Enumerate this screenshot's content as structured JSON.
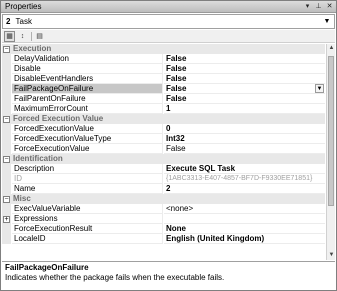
{
  "window": {
    "title": "Properties",
    "buttons": [
      "▾",
      "✕",
      "✕"
    ]
  },
  "selector": {
    "number": "2",
    "text": "Task"
  },
  "toolbar": {
    "tools": [
      {
        "name": "categorized-icon",
        "glyph": "▦",
        "active": true
      },
      {
        "name": "alphabetical-icon",
        "glyph": "↓",
        "active": false
      },
      {
        "name": "property-pages-icon",
        "glyph": "▤",
        "active": false
      }
    ]
  },
  "grid": {
    "rows": [
      {
        "kind": "cat",
        "label": "Execution",
        "toggle": "−"
      },
      {
        "kind": "prop",
        "name": "DelayValidation",
        "value": "False",
        "bold": true
      },
      {
        "kind": "prop",
        "name": "Disable",
        "value": "False",
        "bold": true
      },
      {
        "kind": "prop",
        "name": "DisableEventHandlers",
        "value": "False",
        "bold": true
      },
      {
        "kind": "prop",
        "name": "FailPackageOnFailure",
        "value": "False",
        "bold": true,
        "selected": true,
        "dropdown": true
      },
      {
        "kind": "prop",
        "name": "FailParentOnFailure",
        "value": "False",
        "bold": true
      },
      {
        "kind": "prop",
        "name": "MaximumErrorCount",
        "value": "1",
        "bold": true
      },
      {
        "kind": "cat",
        "label": "Forced Execution Value",
        "toggle": "−"
      },
      {
        "kind": "prop",
        "name": "ForcedExecutionValue",
        "value": "0",
        "bold": true
      },
      {
        "kind": "prop",
        "name": "ForcedExecutionValueType",
        "value": "Int32",
        "bold": true
      },
      {
        "kind": "prop",
        "name": "ForceExecutionValue",
        "value": "False",
        "bold": false
      },
      {
        "kind": "cat",
        "label": "Identification",
        "toggle": "−"
      },
      {
        "kind": "prop",
        "name": "Description",
        "value": "Execute SQL Task",
        "bold": true
      },
      {
        "kind": "prop",
        "name": "ID",
        "value": "{1ABC3313-E407-4857-BF7D-F9330EE71851}",
        "bold": false,
        "grey": true
      },
      {
        "kind": "prop",
        "name": "Name",
        "value": "2",
        "bold": true
      },
      {
        "kind": "cat",
        "label": "Misc",
        "toggle": "−"
      },
      {
        "kind": "prop",
        "name": "ExecValueVariable",
        "value": "<none>",
        "bold": false
      },
      {
        "kind": "prop",
        "name": "Expressions",
        "value": "",
        "bold": false,
        "expander": "+"
      },
      {
        "kind": "prop",
        "name": "ForceExecutionResult",
        "value": "None",
        "bold": true
      },
      {
        "kind": "prop",
        "name": "LocaleID",
        "value": "English (United Kingdom)",
        "bold": true
      }
    ]
  },
  "description": {
    "title": "FailPackageOnFailure",
    "text": "Indicates whether the package fails when the executable fails."
  }
}
